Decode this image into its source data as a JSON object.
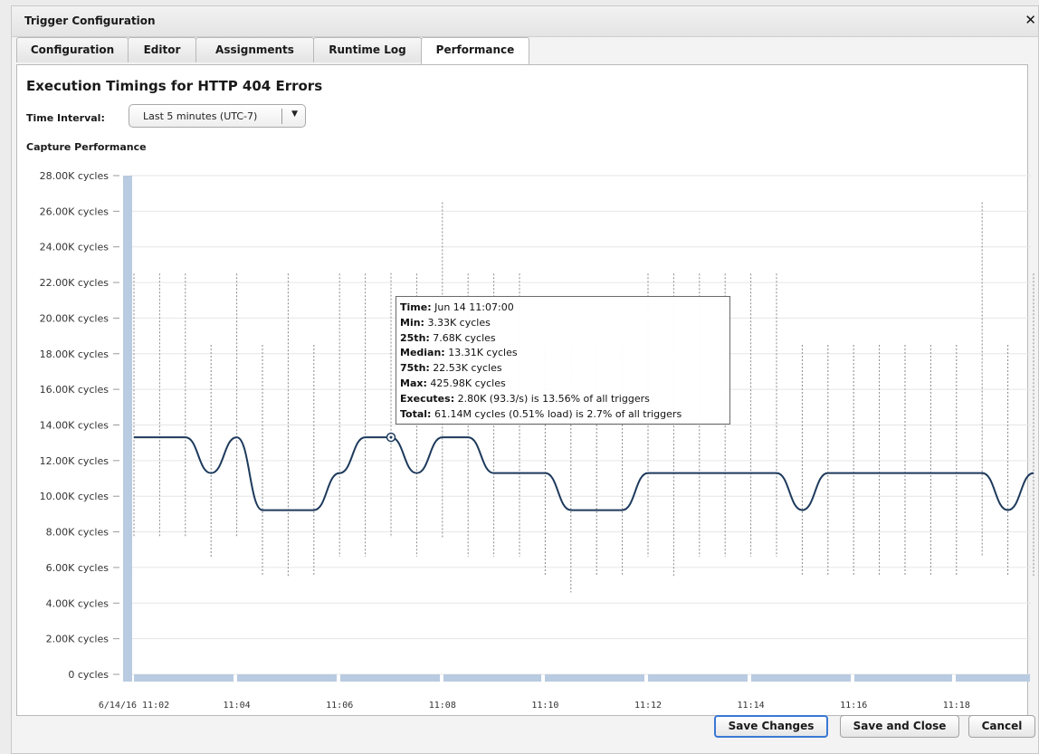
{
  "dialog": {
    "title": "Trigger Configuration",
    "close_glyph": "✕"
  },
  "tabs": [
    {
      "label": "Configuration",
      "active": false
    },
    {
      "label": "Editor",
      "active": false
    },
    {
      "label": "Assignments",
      "active": false
    },
    {
      "label": "Runtime Log",
      "active": false
    },
    {
      "label": "Performance",
      "active": true
    }
  ],
  "page": {
    "heading": "Execution Timings for HTTP 404 Errors",
    "time_interval_label": "Time Interval:",
    "time_interval_value": "Last 5 minutes (UTC-7)",
    "capture_label": "Capture Performance"
  },
  "tooltip": {
    "time_label": "Time:",
    "time_value": "Jun 14 11:07:00",
    "min_label": "Min:",
    "min_value": "3.33K cycles",
    "p25_label": "25th:",
    "p25_value": "7.68K cycles",
    "median_label": "Median:",
    "median_value": "13.31K cycles",
    "p75_label": "75th:",
    "p75_value": "22.53K cycles",
    "max_label": "Max:",
    "max_value": "425.98K cycles",
    "executes_label": "Executes:",
    "executes_value": "2.80K (93.3/s) is 13.56% of all triggers",
    "total_label": "Total:",
    "total_value": "61.14M cycles (0.51% load) is 2.7% of all triggers"
  },
  "footer": {
    "save_changes": "Save Changes",
    "save_and_close": "Save and Close",
    "cancel": "Cancel"
  },
  "colors": {
    "median_line": "#1d3a5c",
    "range_dash": "#8a8a8a",
    "axis_bar": "#b8cbe0",
    "grid": "#e6e6e6"
  },
  "chart_data": {
    "type": "line",
    "title": "Capture Performance",
    "y_unit": "cycles",
    "ylim": [
      0,
      28000
    ],
    "y_ticks": [
      {
        "value": 0,
        "label": "0 cycles"
      },
      {
        "value": 2000,
        "label": "2.00K cycles"
      },
      {
        "value": 4000,
        "label": "4.00K cycles"
      },
      {
        "value": 6000,
        "label": "6.00K cycles"
      },
      {
        "value": 8000,
        "label": "8.00K cycles"
      },
      {
        "value": 10000,
        "label": "10.00K cycles"
      },
      {
        "value": 12000,
        "label": "12.00K cycles"
      },
      {
        "value": 14000,
        "label": "14.00K cycles"
      },
      {
        "value": 16000,
        "label": "16.00K cycles"
      },
      {
        "value": 18000,
        "label": "18.00K cycles"
      },
      {
        "value": 20000,
        "label": "20.00K cycles"
      },
      {
        "value": 22000,
        "label": "22.00K cycles"
      },
      {
        "value": 24000,
        "label": "24.00K cycles"
      },
      {
        "value": 26000,
        "label": "26.00K cycles"
      },
      {
        "value": 28000,
        "label": "28.00K cycles"
      }
    ],
    "xlim": [
      "6/14/16 11:02:00",
      "6/14/16 11:19:45"
    ],
    "x_ticks": [
      {
        "time": "11:02",
        "label": "6/14/16 11:02"
      },
      {
        "time": "11:04",
        "label": "11:04"
      },
      {
        "time": "11:06",
        "label": "11:06"
      },
      {
        "time": "11:08",
        "label": "11:08"
      },
      {
        "time": "11:10",
        "label": "11:10"
      },
      {
        "time": "11:12",
        "label": "11:12"
      },
      {
        "time": "11:14",
        "label": "11:14"
      },
      {
        "time": "11:16",
        "label": "11:16"
      },
      {
        "time": "11:18",
        "label": "11:18"
      }
    ],
    "grid": true,
    "series": [
      {
        "role": "median",
        "points": [
          {
            "time": "11:02:00",
            "value": 13310
          },
          {
            "time": "11:02:30",
            "value": 13310
          },
          {
            "time": "11:03:00",
            "value": 13310
          },
          {
            "time": "11:03:30",
            "value": 11300
          },
          {
            "time": "11:04:00",
            "value": 13310
          },
          {
            "time": "11:04:30",
            "value": 9220
          },
          {
            "time": "11:05:00",
            "value": 9220
          },
          {
            "time": "11:05:30",
            "value": 9220
          },
          {
            "time": "11:06:00",
            "value": 11300
          },
          {
            "time": "11:06:30",
            "value": 13310
          },
          {
            "time": "11:07:00",
            "value": 13310
          },
          {
            "time": "11:07:30",
            "value": 11300
          },
          {
            "time": "11:08:00",
            "value": 13310
          },
          {
            "time": "11:08:30",
            "value": 13310
          },
          {
            "time": "11:09:00",
            "value": 11300
          },
          {
            "time": "11:09:30",
            "value": 11300
          },
          {
            "time": "11:10:00",
            "value": 11300
          },
          {
            "time": "11:10:30",
            "value": 9220
          },
          {
            "time": "11:11:00",
            "value": 9220
          },
          {
            "time": "11:11:30",
            "value": 9220
          },
          {
            "time": "11:12:00",
            "value": 11300
          },
          {
            "time": "11:12:30",
            "value": 11300
          },
          {
            "time": "11:13:00",
            "value": 11300
          },
          {
            "time": "11:13:30",
            "value": 11300
          },
          {
            "time": "11:14:00",
            "value": 11300
          },
          {
            "time": "11:14:30",
            "value": 11300
          },
          {
            "time": "11:15:00",
            "value": 9220
          },
          {
            "time": "11:15:30",
            "value": 11300
          },
          {
            "time": "11:16:00",
            "value": 11300
          },
          {
            "time": "11:16:30",
            "value": 11300
          },
          {
            "time": "11:17:00",
            "value": 11300
          },
          {
            "time": "11:17:30",
            "value": 11300
          },
          {
            "time": "11:18:00",
            "value": 11300
          },
          {
            "time": "11:18:30",
            "value": 11300
          },
          {
            "time": "11:19:00",
            "value": 9220
          },
          {
            "time": "11:19:30",
            "value": 11300
          }
        ]
      },
      {
        "role": "range_25th_75th",
        "points": [
          {
            "time": "11:02:00",
            "low": 7700,
            "high": 22500
          },
          {
            "time": "11:02:30",
            "low": 7700,
            "high": 22500
          },
          {
            "time": "11:03:00",
            "low": 7700,
            "high": 22500
          },
          {
            "time": "11:03:30",
            "low": 6600,
            "high": 18500
          },
          {
            "time": "11:04:00",
            "low": 7700,
            "high": 22500
          },
          {
            "time": "11:04:30",
            "low": 5500,
            "high": 18500
          },
          {
            "time": "11:05:00",
            "low": 5500,
            "high": 22500
          },
          {
            "time": "11:05:30",
            "low": 5500,
            "high": 18500
          },
          {
            "time": "11:06:00",
            "low": 6600,
            "high": 22500
          },
          {
            "time": "11:06:30",
            "low": 6600,
            "high": 22500
          },
          {
            "time": "11:07:00",
            "low": 7680,
            "high": 22530
          },
          {
            "time": "11:07:30",
            "low": 6600,
            "high": 22500
          },
          {
            "time": "11:08:00",
            "low": 7700,
            "high": 26500
          },
          {
            "time": "11:08:30",
            "low": 6600,
            "high": 22500
          },
          {
            "time": "11:09:00",
            "low": 6600,
            "high": 22500
          },
          {
            "time": "11:09:30",
            "low": 6600,
            "high": 22500
          },
          {
            "time": "11:10:00",
            "low": 5500,
            "high": 18500
          },
          {
            "time": "11:10:30",
            "low": 4600,
            "high": 18500
          },
          {
            "time": "11:11:00",
            "low": 5500,
            "high": 18500
          },
          {
            "time": "11:11:30",
            "low": 5500,
            "high": 18500
          },
          {
            "time": "11:12:00",
            "low": 6600,
            "high": 22500
          },
          {
            "time": "11:12:30",
            "low": 5500,
            "high": 22500
          },
          {
            "time": "11:13:00",
            "low": 6600,
            "high": 22500
          },
          {
            "time": "11:13:30",
            "low": 6600,
            "high": 22500
          },
          {
            "time": "11:14:00",
            "low": 6600,
            "high": 22500
          },
          {
            "time": "11:14:30",
            "low": 6600,
            "high": 22500
          },
          {
            "time": "11:15:00",
            "low": 5500,
            "high": 18500
          },
          {
            "time": "11:15:30",
            "low": 5500,
            "high": 18500
          },
          {
            "time": "11:16:00",
            "low": 5500,
            "high": 18500
          },
          {
            "time": "11:16:30",
            "low": 5500,
            "high": 18500
          },
          {
            "time": "11:17:00",
            "low": 5500,
            "high": 18500
          },
          {
            "time": "11:17:30",
            "low": 5500,
            "high": 18500
          },
          {
            "time": "11:18:00",
            "low": 5500,
            "high": 18500
          },
          {
            "time": "11:18:30",
            "low": 6600,
            "high": 26500
          },
          {
            "time": "11:19:00",
            "low": 5500,
            "high": 18500
          },
          {
            "time": "11:19:30",
            "low": 5500,
            "high": 22500
          }
        ]
      }
    ],
    "highlighted_point": {
      "time": "11:07:00",
      "value": 13310
    }
  }
}
